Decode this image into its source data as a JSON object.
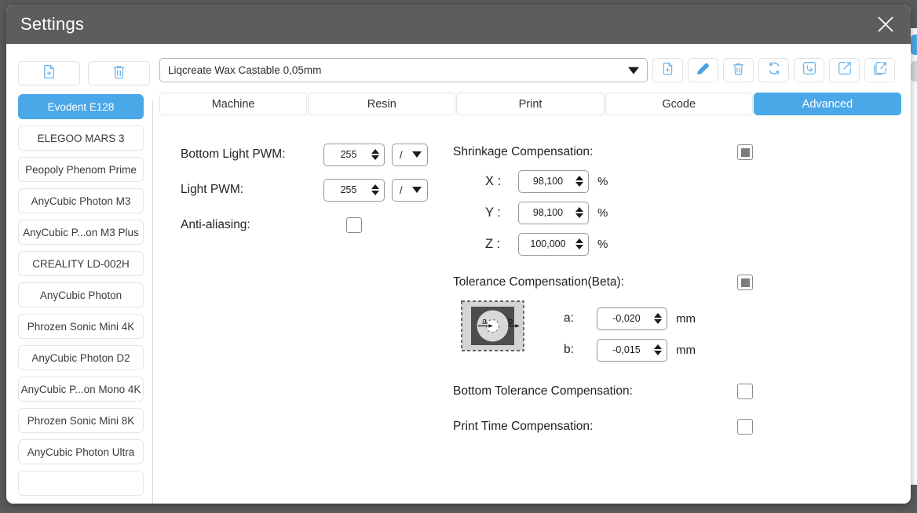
{
  "window": {
    "title": "Settings",
    "close_icon": "close-icon",
    "accent_color": "#4aa8e8",
    "titlebar_color": "#5d5d5d",
    "desktop_color": "#5a5a5a"
  },
  "left_toolbar": {
    "buttons": [
      {
        "name": "new-profile-button",
        "icon": "file-plus-icon"
      },
      {
        "name": "delete-profile-button",
        "icon": "trash-icon"
      }
    ]
  },
  "printer_list": {
    "items": [
      {
        "label": "Evodent E128",
        "selected": true
      },
      {
        "label": "ELEGOO MARS 3",
        "selected": false
      },
      {
        "label": "Peopoly Phenom Prime",
        "selected": false
      },
      {
        "label": "AnyCubic Photon M3",
        "selected": false
      },
      {
        "label": "AnyCubic P...on M3 Plus",
        "selected": false
      },
      {
        "label": "CREALITY LD-002H",
        "selected": false
      },
      {
        "label": "AnyCubic Photon",
        "selected": false
      },
      {
        "label": "Phrozen Sonic Mini 4K",
        "selected": false
      },
      {
        "label": "AnyCubic Photon D2",
        "selected": false
      },
      {
        "label": "AnyCubic P...on Mono 4K",
        "selected": false
      },
      {
        "label": "Phrozen Sonic Mini 8K",
        "selected": false
      },
      {
        "label": "AnyCubic Photon Ultra",
        "selected": false
      },
      {
        "label": "",
        "selected": false
      }
    ]
  },
  "profile": {
    "selected": "Liqcreate Wax Castable 0,05mm",
    "dropdown_icon": "chevron-down-icon",
    "actions": [
      {
        "name": "add-resin-button",
        "icon": "file-plus-icon"
      },
      {
        "name": "edit-resin-button",
        "icon": "pencil-icon"
      },
      {
        "name": "delete-resin-button",
        "icon": "trash-icon"
      },
      {
        "name": "refresh-resin-button",
        "icon": "refresh-icon"
      },
      {
        "name": "import-resin-button",
        "icon": "import-arrow-icon"
      },
      {
        "name": "export-resin-button",
        "icon": "export-arrow-icon"
      },
      {
        "name": "export-all-resin-button",
        "icon": "export-copy-icon"
      }
    ]
  },
  "tabs": [
    {
      "label": "Machine",
      "active": false
    },
    {
      "label": "Resin",
      "active": false
    },
    {
      "label": "Print",
      "active": false
    },
    {
      "label": "Gcode",
      "active": false
    },
    {
      "label": "Advanced",
      "active": true
    }
  ],
  "advanced": {
    "bottom_light_pwm": {
      "label": "Bottom Light PWM:",
      "value": "255",
      "unit": "/"
    },
    "light_pwm": {
      "label": "Light PWM:",
      "value": "255",
      "unit": "/"
    },
    "anti_aliasing": {
      "label": "Anti-aliasing:",
      "state": "unchecked"
    },
    "shrinkage_compensation": {
      "label": "Shrinkage Compensation:",
      "state": "partial",
      "axes": [
        {
          "label": "X :",
          "value": "98,100",
          "unit": "%"
        },
        {
          "label": "Y :",
          "value": "98,100",
          "unit": "%"
        },
        {
          "label": "Z :",
          "value": "100,000",
          "unit": "%"
        }
      ]
    },
    "tolerance_compensation": {
      "label": "Tolerance Compensation(Beta):",
      "state": "partial",
      "diagram_name": "tolerance-diagram",
      "diagram_labels": {
        "outer": "a",
        "inner": "b"
      },
      "params": [
        {
          "label": "a:",
          "value": "-0,020",
          "unit": "mm"
        },
        {
          "label": "b:",
          "value": "-0,015",
          "unit": "mm"
        }
      ]
    },
    "bottom_tolerance_compensation": {
      "label": "Bottom Tolerance Compensation:",
      "state": "unchecked"
    },
    "print_time_compensation": {
      "label": "Print Time Compensation:",
      "state": "unchecked"
    }
  }
}
